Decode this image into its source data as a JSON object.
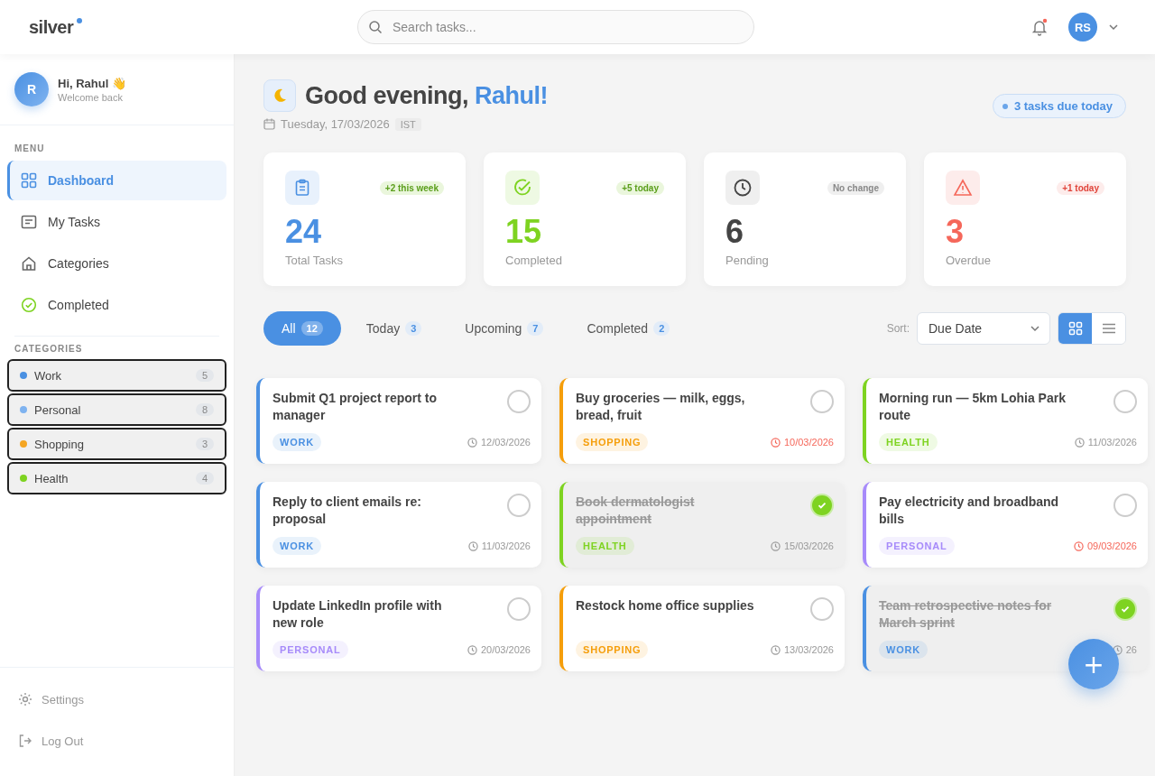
{
  "brand": {
    "name": "silver"
  },
  "search": {
    "placeholder": "Search tasks..."
  },
  "notifications": {
    "unread": true
  },
  "user": {
    "initials": "RS"
  },
  "profile": {
    "initial": "R",
    "greeting": "Hi, Rahul 👋",
    "subtitle": "Welcome back"
  },
  "menu": {
    "heading": "MENU",
    "items": [
      {
        "kind": "dashboard",
        "label": "Dashboard",
        "selected": true
      },
      {
        "kind": "tasks",
        "label": "My Tasks",
        "selected": false
      },
      {
        "kind": "categories",
        "label": "Categories",
        "selected": false
      },
      {
        "kind": "completed",
        "label": "Completed",
        "selected": false
      }
    ]
  },
  "categories": {
    "heading": "CATEGORIES",
    "items": [
      {
        "label": "Work",
        "count": "5",
        "color": "#4a90e2"
      },
      {
        "label": "Personal",
        "count": "8",
        "color": "#7fb3f0"
      },
      {
        "label": "Shopping",
        "count": "3",
        "color": "#f5a623"
      },
      {
        "label": "Health",
        "count": "4",
        "color": "#7ed321"
      }
    ]
  },
  "footer_links": [
    {
      "kind": "settings",
      "label": "Settings"
    },
    {
      "kind": "logout",
      "label": "Log Out"
    }
  ],
  "heading": {
    "greeting": "Good evening, ",
    "name": "Rahul!",
    "date": "Tuesday, 17/03/2026",
    "timezone": "IST",
    "due_badge": "3 tasks due today"
  },
  "stats": [
    {
      "kind": "total",
      "value": "24",
      "label": "Total Tasks",
      "change": "+2 this week"
    },
    {
      "kind": "completed",
      "value": "15",
      "label": "Completed",
      "change": "+5 today"
    },
    {
      "kind": "pending",
      "value": "6",
      "label": "Pending",
      "change": "No change"
    },
    {
      "kind": "overdue",
      "value": "3",
      "label": "Overdue",
      "change": "+1 today"
    }
  ],
  "tabs": [
    {
      "label": "All",
      "count": "12",
      "selected": true
    },
    {
      "label": "Today",
      "count": "3",
      "selected": false
    },
    {
      "label": "Upcoming",
      "count": "7",
      "selected": false
    },
    {
      "label": "Completed",
      "count": "2",
      "selected": false
    }
  ],
  "sort": {
    "label": "Sort:",
    "value": "Due Date"
  },
  "views": [
    {
      "kind": "grid",
      "selected": true
    },
    {
      "kind": "list",
      "selected": false
    }
  ],
  "tasks": [
    {
      "title": "Submit Q1 project report to manager",
      "category": "WORK",
      "color": "#4a90e2",
      "date": "12/03/2026",
      "overdue": false,
      "done": false
    },
    {
      "title": "Buy groceries — milk, eggs, bread, fruit",
      "category": "SHOPPING",
      "color": "#f59e0b",
      "date": "10/03/2026",
      "overdue": true,
      "done": false
    },
    {
      "title": "Morning run — 5km Lohia Park route",
      "category": "HEALTH",
      "color": "#7ed321",
      "date": "11/03/2026",
      "overdue": false,
      "done": false
    },
    {
      "title": "Reply to client emails re: proposal",
      "category": "WORK",
      "color": "#4a90e2",
      "date": "11/03/2026",
      "overdue": false,
      "done": false
    },
    {
      "title": "Book dermatologist appointment",
      "category": "HEALTH",
      "color": "#7ed321",
      "date": "15/03/2026",
      "overdue": false,
      "done": true
    },
    {
      "title": "Pay electricity and broadband bills",
      "category": "PERSONAL",
      "color": "#a78bfa",
      "date": "09/03/2026",
      "overdue": true,
      "done": false
    },
    {
      "title": "Update LinkedIn profile with new role",
      "category": "PERSONAL",
      "color": "#a78bfa",
      "date": "20/03/2026",
      "overdue": false,
      "done": false
    },
    {
      "title": "Restock home office supplies",
      "category": "SHOPPING",
      "color": "#f59e0b",
      "date": "13/03/2026",
      "overdue": false,
      "done": false
    },
    {
      "title": "Team retrospective notes for March sprint",
      "category": "WORK",
      "color": "#4a90e2",
      "date": "26",
      "overdue": false,
      "done": true
    }
  ],
  "fab": {
    "label": "+"
  }
}
